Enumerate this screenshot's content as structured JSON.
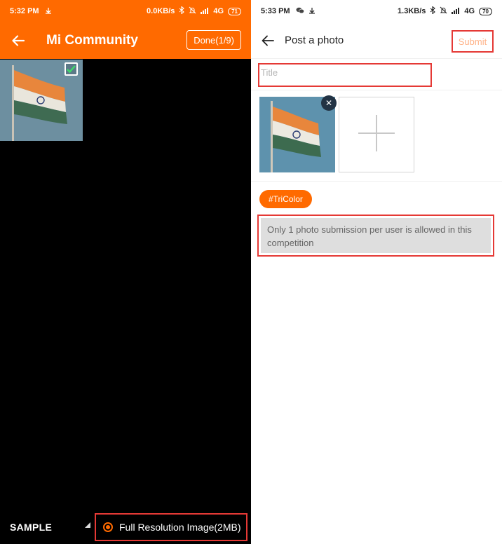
{
  "left": {
    "status": {
      "time": "5:32 PM",
      "speed": "0.0KB/s",
      "network": "4G",
      "battery": "71"
    },
    "toolbar": {
      "title": "Mi Community",
      "done_label": "Done(1/9)"
    },
    "bottom": {
      "album_label": "SAMPLE",
      "full_res_label": "Full Resolution Image(2MB)"
    }
  },
  "right": {
    "status": {
      "time": "5:33 PM",
      "speed": "1.3KB/s",
      "network": "4G",
      "battery": "70"
    },
    "toolbar": {
      "title": "Post a photo",
      "submit_label": "Submit"
    },
    "title_input": {
      "placeholder": "Title",
      "value": ""
    },
    "tag": "#TriColor",
    "notice": "Only 1 photo submission per user is allowed in this competition"
  },
  "colors": {
    "accent": "#ff6a00",
    "highlight_border": "#e53935",
    "submit_disabled": "#ffb48a"
  }
}
